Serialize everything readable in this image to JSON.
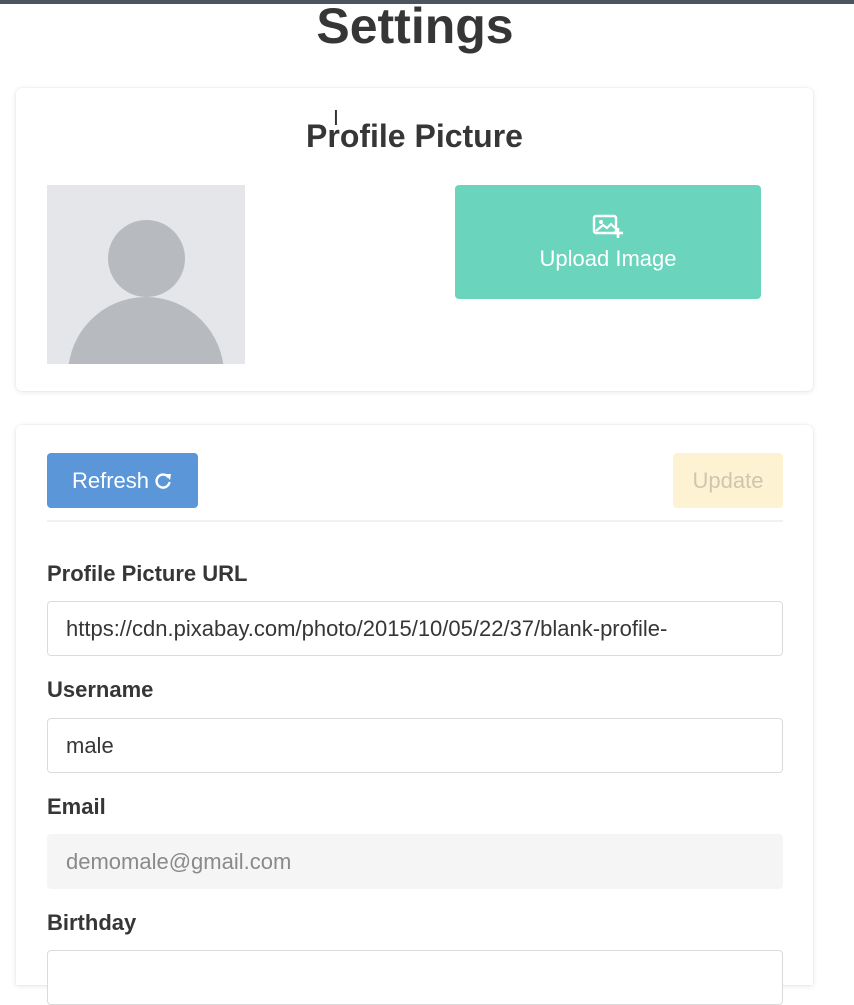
{
  "page": {
    "title": "Settings"
  },
  "profile_card": {
    "title": "Profile Picture",
    "avatar_icon": "default-avatar-icon",
    "upload_button": {
      "label": "Upload Image",
      "icon": "image-add-icon",
      "color": "#6bd4bd"
    }
  },
  "form_card": {
    "refresh_button": {
      "label": "Refresh",
      "icon": "refresh-icon",
      "color": "#5b97d8"
    },
    "update_button": {
      "label": "Update",
      "color": "#fdf3d3"
    },
    "fields": {
      "profile_picture_url": {
        "label": "Profile Picture URL",
        "value": "https://cdn.pixabay.com/photo/2015/10/05/22/37/blank-profile-"
      },
      "username": {
        "label": "Username",
        "value": "male"
      },
      "email": {
        "label": "Email",
        "value": "demomale@gmail.com"
      },
      "birthday": {
        "label": "Birthday",
        "value": ""
      }
    }
  }
}
